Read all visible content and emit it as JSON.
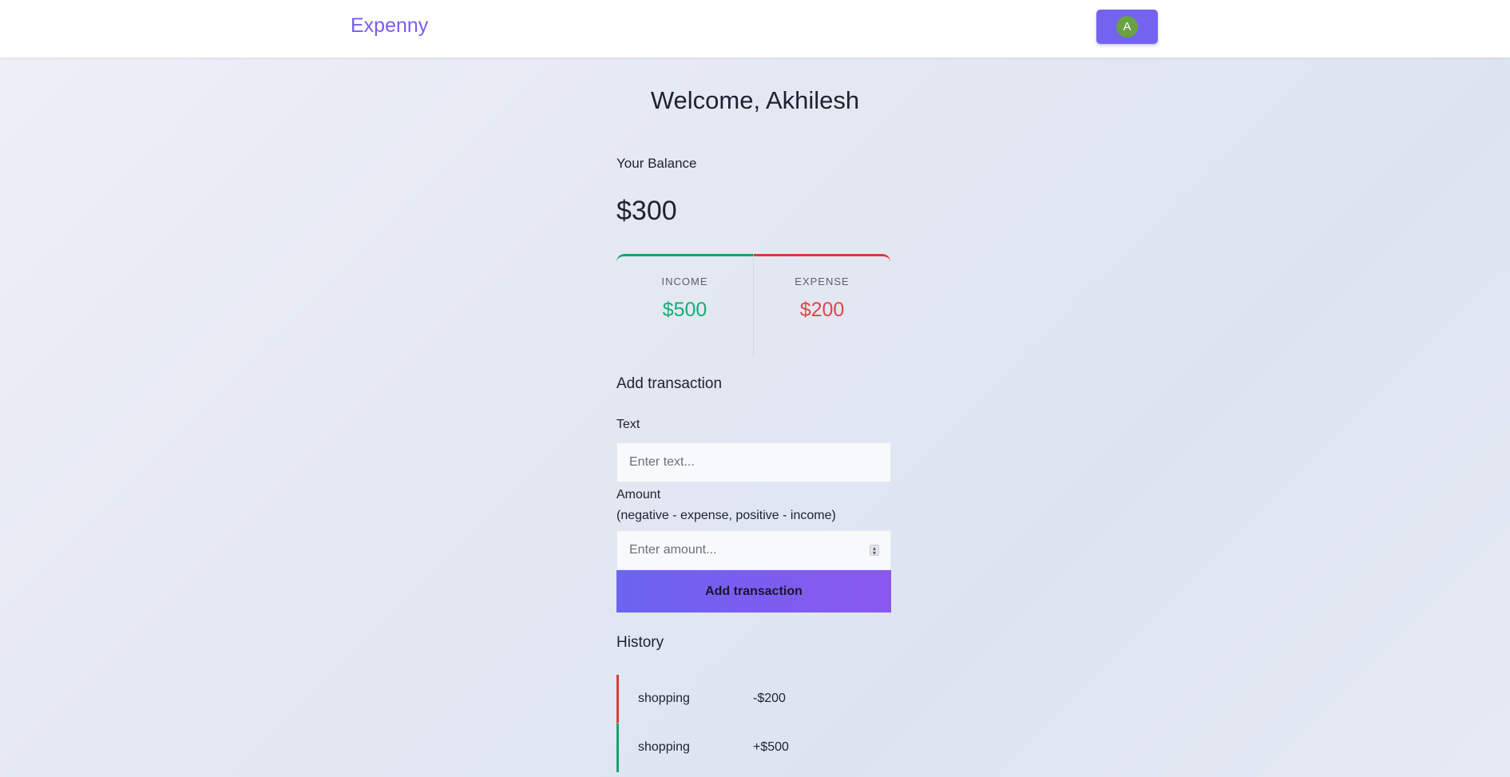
{
  "app": {
    "brand": "Expenny",
    "user_initial": "A",
    "colors": {
      "brand": "#7b5cf0",
      "primary_button": "#7463ef",
      "avatar": "#6aa243",
      "income": "#12b073",
      "expense": "#e04545"
    }
  },
  "welcome": {
    "text": "Welcome, Akhilesh"
  },
  "balance": {
    "label": "Your Balance",
    "amount": "$300"
  },
  "summary": {
    "income_label": "INCOME",
    "income_value": "$500",
    "expense_label": "EXPENSE",
    "expense_value": "$200"
  },
  "form": {
    "heading": "Add transaction",
    "text_label": "Text",
    "text_placeholder": "Enter text...",
    "amount_label": "Amount",
    "amount_hint": "(negative - expense, positive - income)",
    "amount_placeholder": "Enter amount...",
    "submit_label": "Add transaction"
  },
  "history": {
    "heading": "History",
    "items": [
      {
        "text": "shopping",
        "amount": "-$200",
        "type": "expense"
      },
      {
        "text": "shopping",
        "amount": "+$500",
        "type": "income"
      }
    ]
  }
}
